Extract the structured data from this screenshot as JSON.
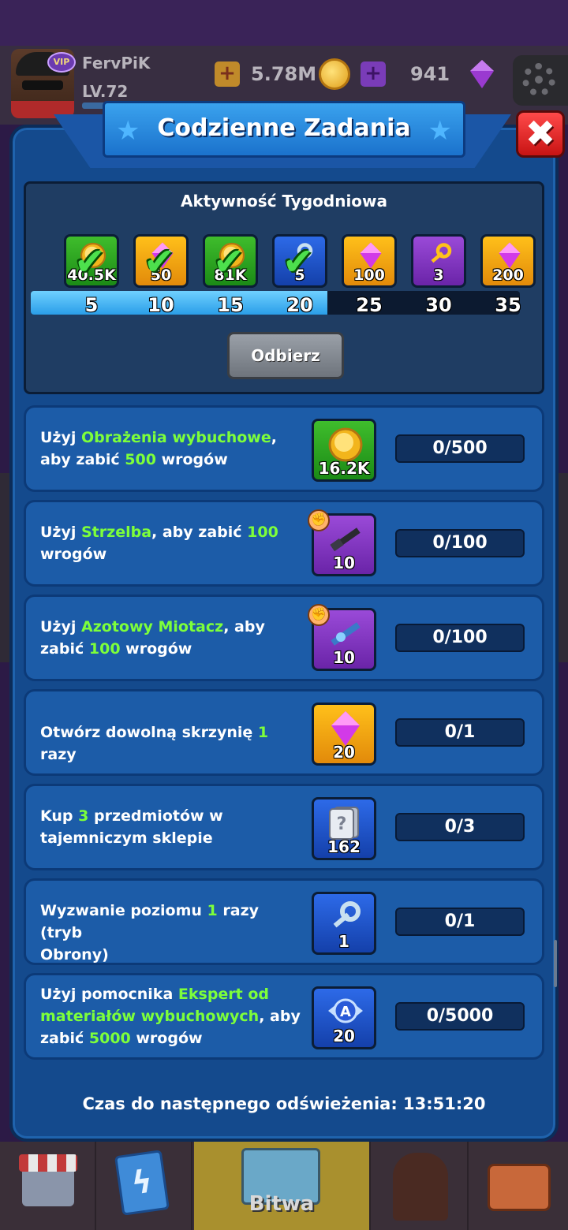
{
  "header": {
    "player_name": "FervPiK",
    "player_level": "LV.72",
    "vip_label": "VIP",
    "coins": "5.78M",
    "gems": "941"
  },
  "dialog": {
    "title": "Codzienne Zadania",
    "close_icon": "close-icon"
  },
  "weekly": {
    "title": "Aktywność Tygodniowa",
    "progress_points": 20,
    "progress_max": 35,
    "milestones": [
      {
        "threshold": "5",
        "reward": "40.5K",
        "item": "gold-coin-icon",
        "color": "green",
        "claimed": true
      },
      {
        "threshold": "10",
        "reward": "50",
        "item": "gem-icon",
        "color": "yellow",
        "claimed": true
      },
      {
        "threshold": "15",
        "reward": "81K",
        "item": "gold-coin-icon",
        "color": "green",
        "claimed": true
      },
      {
        "threshold": "20",
        "reward": "5",
        "item": "key-icon",
        "color": "blue",
        "claimed": true
      },
      {
        "threshold": "25",
        "reward": "100",
        "item": "gem-icon",
        "color": "yellow",
        "claimed": false
      },
      {
        "threshold": "30",
        "reward": "3",
        "item": "gold-key-icon",
        "color": "purple",
        "claimed": false
      },
      {
        "threshold": "35",
        "reward": "200",
        "item": "gem-icon",
        "color": "yellow",
        "claimed": false
      }
    ],
    "claim_label": "Odbierz"
  },
  "tasks": [
    {
      "line1": [
        [
          "Użyj ",
          false
        ],
        [
          "Obrażenia wybuchowe",
          true
        ],
        [
          ",",
          false
        ]
      ],
      "line2": [
        [
          "aby zabić ",
          false
        ],
        [
          "500",
          true
        ],
        [
          " wrogów",
          false
        ]
      ],
      "line3": [],
      "reward": "16.2K",
      "reward_icon": "gold-coin-icon",
      "reward_color": "green",
      "progress": "0/500"
    },
    {
      "line1": [
        [
          "Użyj ",
          false
        ],
        [
          "Strzelba",
          true
        ],
        [
          ", aby zabić ",
          false
        ],
        [
          "100",
          true
        ]
      ],
      "line2": [
        [
          "wrogów",
          false
        ]
      ],
      "line3": [],
      "reward": "10",
      "reward_icon": "shotgun-icon",
      "reward_color": "purple",
      "progress": "0/100"
    },
    {
      "line1": [
        [
          "Użyj ",
          false
        ],
        [
          "Azotowy Miotacz",
          true
        ],
        [
          ", aby",
          false
        ]
      ],
      "line2": [
        [
          "zabić ",
          false
        ],
        [
          "100",
          true
        ],
        [
          " wrogów",
          false
        ]
      ],
      "line3": [],
      "reward": "10",
      "reward_icon": "nitrogen-thrower-icon",
      "reward_color": "purple",
      "progress": "0/100"
    },
    {
      "line1": [
        [
          "Otwórz dowolną skrzynię ",
          false
        ],
        [
          "1",
          true
        ],
        [
          " razy",
          false
        ]
      ],
      "line2": [],
      "line3": [],
      "reward": "20",
      "reward_icon": "gem-icon",
      "reward_color": "yellow",
      "progress": "0/1"
    },
    {
      "line1": [
        [
          "Kup ",
          false
        ],
        [
          "3",
          true
        ],
        [
          " przedmiotów w",
          false
        ]
      ],
      "line2": [
        [
          "tajemniczym sklepie",
          false
        ]
      ],
      "line3": [],
      "reward": "162",
      "reward_icon": "mystery-card-icon",
      "reward_color": "blue",
      "progress": "0/3"
    },
    {
      "line1": [
        [
          "Wyzwanie poziomu ",
          false
        ],
        [
          "1",
          true
        ],
        [
          " razy (tryb",
          false
        ]
      ],
      "line2": [
        [
          "Obrony)",
          false
        ]
      ],
      "line3": [],
      "reward": "1",
      "reward_icon": "key-icon",
      "reward_color": "blue",
      "progress": "0/1"
    },
    {
      "line1": [
        [
          "Użyj pomocnika ",
          false
        ],
        [
          "Ekspert od",
          true
        ]
      ],
      "line2": [
        [
          "materiałów wybuchowych",
          true
        ],
        [
          ", aby",
          false
        ]
      ],
      "line3": [
        [
          "zabić ",
          false
        ],
        [
          "5000",
          true
        ],
        [
          " wrogów",
          false
        ]
      ],
      "reward": "20",
      "reward_icon": "rank-a-badge-icon",
      "reward_color": "blue",
      "progress": "0/5000"
    }
  ],
  "refresh_text": "Czas do następnego odświeżenia: 13:51:20",
  "nav": {
    "battle_label": "Bitwa"
  },
  "colors": {
    "highlight": "#7dff3a",
    "panel": "#144a8d",
    "task_card": "#1c5ca8"
  }
}
